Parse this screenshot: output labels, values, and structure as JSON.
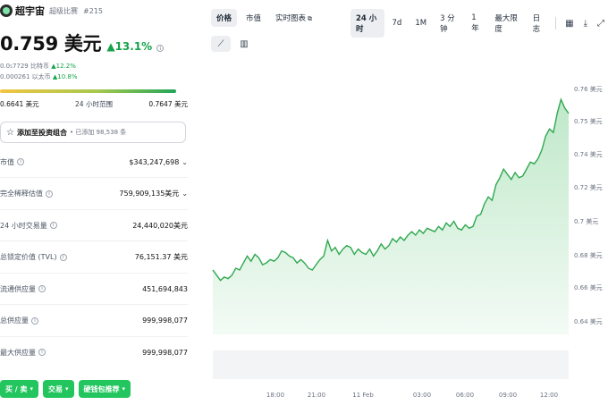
{
  "coin": {
    "name": "超宇宙",
    "symbol": "超级比赛",
    "rank": "#215"
  },
  "price": {
    "value": "0.759 美元",
    "change": "13.1%"
  },
  "sub": {
    "btc": "0.0₅7729 比特币",
    "btc_change": "12.2%",
    "eth": "0.000261 以太币",
    "eth_change": "10.8%"
  },
  "range": {
    "low": "0.6641 美元",
    "label": "24 小时范围",
    "high": "0.7647 美元",
    "position": 1.0
  },
  "portfolio": {
    "label": "添加至投资组合",
    "count": "• 已添加 98,538 条"
  },
  "stats": [
    {
      "label": "市值",
      "value": "$343,247,698",
      "dropdown": true
    },
    {
      "label": "完全稀释估值",
      "value": "759,909,135美元",
      "dropdown": true
    },
    {
      "label": "24 小时交易量",
      "value": "24,440,020美元",
      "dropdown": false
    },
    {
      "label": "总锁定价值 (TVL)",
      "value": "76,151.37 美元",
      "dropdown": false
    },
    {
      "label": "流通供应量",
      "value": "451,694,843",
      "dropdown": false
    },
    {
      "label": "总供应量",
      "value": "999,998,077",
      "dropdown": false
    },
    {
      "label": "最大供应量",
      "value": "999,998,077",
      "dropdown": false
    }
  ],
  "buttons": {
    "buy": "买 / 卖",
    "exchange": "交易",
    "wallet": "硬钱包推荐"
  },
  "tabs": [
    "价格",
    "市值",
    "实时图表"
  ],
  "ranges": [
    "24 小时",
    "7d",
    "1M",
    "3 分钟",
    "1年",
    "最大限度",
    "日志"
  ],
  "colors": {
    "accent": "#22c55e",
    "line": "#2fa84f",
    "fill": "#d7f1dd"
  },
  "icons": {
    "star": "star-icon",
    "calendar": "calendar-icon",
    "download": "download-icon",
    "expand": "expand-icon",
    "line": "line-chart-icon",
    "candle": "candlestick-icon"
  },
  "chart_data": {
    "type": "area",
    "y_ticks": [
      "0.76 美元",
      "0.75 美元",
      "0.74 美元",
      "0.72 美元",
      "0.7 美元",
      "0.68 美元",
      "0.66 美元",
      "0.64 美元"
    ],
    "x_ticks": [
      "18:00",
      "21:00",
      "11 Feb",
      "03:00",
      "06:00",
      "09:00",
      "12:00"
    ],
    "ylim": [
      0.63,
      0.78
    ],
    "values": [
      0.667,
      0.664,
      0.661,
      0.663,
      0.662,
      0.664,
      0.668,
      0.667,
      0.671,
      0.675,
      0.672,
      0.676,
      0.674,
      0.67,
      0.671,
      0.673,
      0.672,
      0.674,
      0.678,
      0.677,
      0.675,
      0.674,
      0.671,
      0.673,
      0.671,
      0.668,
      0.667,
      0.67,
      0.673,
      0.675,
      0.684,
      0.678,
      0.68,
      0.676,
      0.679,
      0.681,
      0.68,
      0.676,
      0.679,
      0.677,
      0.676,
      0.679,
      0.675,
      0.678,
      0.682,
      0.679,
      0.681,
      0.685,
      0.683,
      0.686,
      0.684,
      0.687,
      0.689,
      0.687,
      0.69,
      0.688,
      0.691,
      0.69,
      0.689,
      0.692,
      0.69,
      0.694,
      0.692,
      0.695,
      0.691,
      0.69,
      0.693,
      0.691,
      0.692,
      0.698,
      0.699,
      0.705,
      0.709,
      0.707,
      0.716,
      0.72,
      0.725,
      0.722,
      0.719,
      0.723,
      0.72,
      0.721,
      0.725,
      0.729,
      0.728,
      0.731,
      0.736,
      0.744,
      0.748,
      0.746,
      0.757,
      0.765,
      0.76,
      0.757
    ]
  }
}
